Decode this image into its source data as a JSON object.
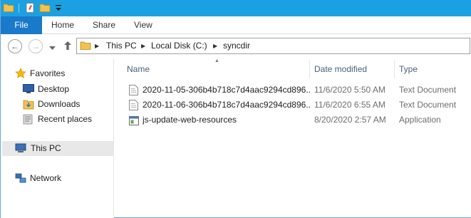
{
  "ribbon": {
    "tabs": [
      {
        "label": "File"
      },
      {
        "label": "Home"
      },
      {
        "label": "Share"
      },
      {
        "label": "View"
      }
    ]
  },
  "address": {
    "crumbs": [
      "This PC",
      "Local Disk (C:)",
      "syncdir"
    ]
  },
  "nav_pane": {
    "favorites": "Favorites",
    "items": [
      "Desktop",
      "Downloads",
      "Recent places"
    ],
    "this_pc": "This PC",
    "network": "Network"
  },
  "file_list": {
    "columns": {
      "name": "Name",
      "date": "Date modified",
      "type": "Type"
    },
    "rows": [
      {
        "name": "2020-11-05-306b4b718c7d4aac9294cd896...",
        "date": "11/6/2020 5:50 AM",
        "type": "Text Document",
        "icon": "text-document-icon"
      },
      {
        "name": "2020-11-06-306b4b718c7d4aac9294cd896...",
        "date": "11/6/2020 6:55 AM",
        "type": "Text Document",
        "icon": "text-document-icon"
      },
      {
        "name": "js-update-web-resources",
        "date": "8/20/2020 2:57 AM",
        "type": "Application",
        "icon": "application-icon"
      }
    ]
  },
  "colors": {
    "titlebar": "#1ba1e2",
    "file_tab": "#1979ca",
    "selection": "#e8e8e8"
  }
}
